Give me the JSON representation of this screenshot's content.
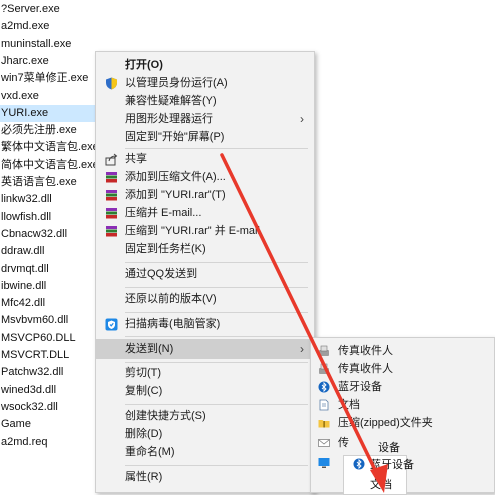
{
  "files": [
    "?Server.exe",
    "a2md.exe",
    "muninstall.exe",
    "Jharc.exe",
    "win7菜单修正.exe",
    "vxd.exe",
    "YURI.exe",
    "必须先注册.exe",
    "繁体中文语言包.exe",
    "简体中文语言包.exe",
    "英语语言包.exe",
    "linkw32.dll",
    "llowfish.dll",
    "Cbnacw32.dll",
    "ddraw.dll",
    "drvmqt.dll",
    "ibwine.dll",
    "Mfc42.dll",
    "Msvbvm60.dll",
    "MSVCP60.DLL",
    "MSVCRT.DLL",
    "Patchw32.dll",
    "wined3d.dll",
    "wsock32.dll",
    "Game",
    "a2md.req"
  ],
  "selected_file_index": 6,
  "context_menu": {
    "items": [
      {
        "label": "打开(O)",
        "icon": "none",
        "bold": true
      },
      {
        "label": "以管理员身份运行(A)",
        "icon": "shield-icon"
      },
      {
        "label": "兼容性疑难解答(Y)",
        "icon": "none"
      },
      {
        "label": "用图形处理器运行",
        "icon": "none",
        "submenu": true
      },
      {
        "label": "固定到\"开始\"屏幕(P)",
        "icon": "none"
      },
      {
        "label": "共享",
        "icon": "share-icon"
      },
      {
        "label": "添加到压缩文件(A)...",
        "icon": "winrar-icon"
      },
      {
        "label": "添加到 \"YURI.rar\"(T)",
        "icon": "winrar-icon"
      },
      {
        "label": "压缩并 E-mail...",
        "icon": "winrar-icon"
      },
      {
        "label": "压缩到 \"YURI.rar\" 并 E-mail",
        "icon": "winrar-icon"
      },
      {
        "label": "固定到任务栏(K)",
        "icon": "none"
      },
      {
        "label": "通过QQ发送到",
        "icon": "none"
      },
      {
        "label": "还原以前的版本(V)",
        "icon": "none"
      },
      {
        "label": "扫描病毒(电脑管家)",
        "icon": "guard-icon"
      },
      {
        "label": "发送到(N)",
        "icon": "none",
        "submenu": true,
        "highlight": true
      },
      {
        "label": "剪切(T)",
        "icon": "none"
      },
      {
        "label": "复制(C)",
        "icon": "none"
      },
      {
        "label": "创建快捷方式(S)",
        "icon": "none"
      },
      {
        "label": "删除(D)",
        "icon": "none"
      },
      {
        "label": "重命名(M)",
        "icon": "none"
      },
      {
        "label": "属性(R)",
        "icon": "none"
      }
    ],
    "submenu_arrow": "›"
  },
  "send_to_menu": {
    "items": [
      {
        "label": "传真收件人",
        "icon": "fax-icon"
      },
      {
        "label": "传真收件人",
        "icon": "fax-icon"
      },
      {
        "label": "蓝牙设备",
        "icon": "bluetooth-icon"
      },
      {
        "label": "文档",
        "icon": "document-icon"
      },
      {
        "label": "压缩(zipped)文件夹",
        "icon": "zip-folder-icon"
      },
      {
        "label": "传",
        "icon": "mail-icon"
      },
      {
        "label": "",
        "icon": "desktop-icon"
      }
    ]
  },
  "overlay": {
    "text_a": "设备",
    "text_b": "蓝牙设备",
    "text_c": "文档"
  },
  "colors": {
    "selection": "#cce8ff",
    "menu_bg": "#f2f2f2",
    "menu_highlight": "#cfcfcf",
    "arrow_red": "#e8392b"
  }
}
